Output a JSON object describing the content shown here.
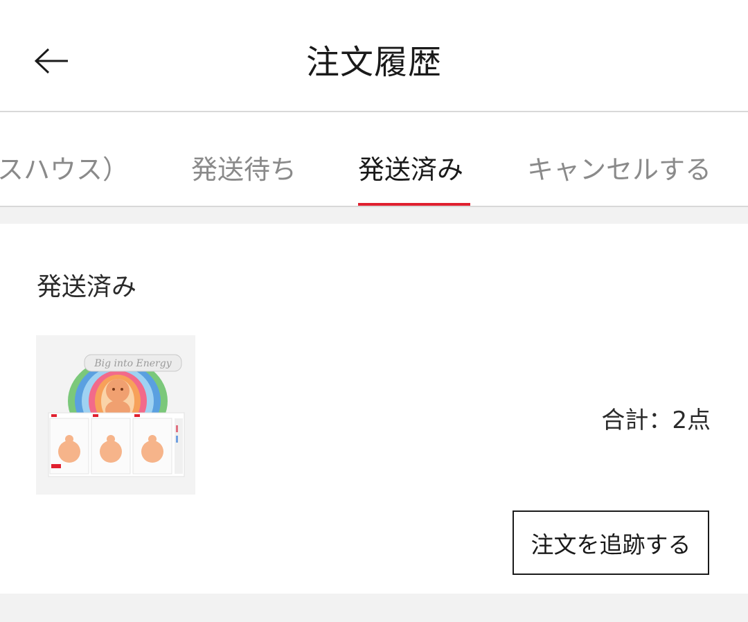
{
  "header": {
    "title": "注文履歴",
    "back_icon": "arrow-left-icon"
  },
  "tabs": [
    {
      "label": "スハウス）",
      "active": false
    },
    {
      "label": "発送待ち",
      "active": false
    },
    {
      "label": "発送済み",
      "active": true
    },
    {
      "label": "キャンセルする",
      "active": false
    }
  ],
  "order": {
    "status": "発送済み",
    "product_image_text": "Big into Energy",
    "total_label": "合計：2点",
    "track_button_label": "注文を追跡する"
  },
  "colors": {
    "accent": "#e0202f",
    "text_primary": "#1a1a1a",
    "text_secondary": "#8a8a8a",
    "divider": "#d8d8d8",
    "band": "#f2f2f2"
  }
}
